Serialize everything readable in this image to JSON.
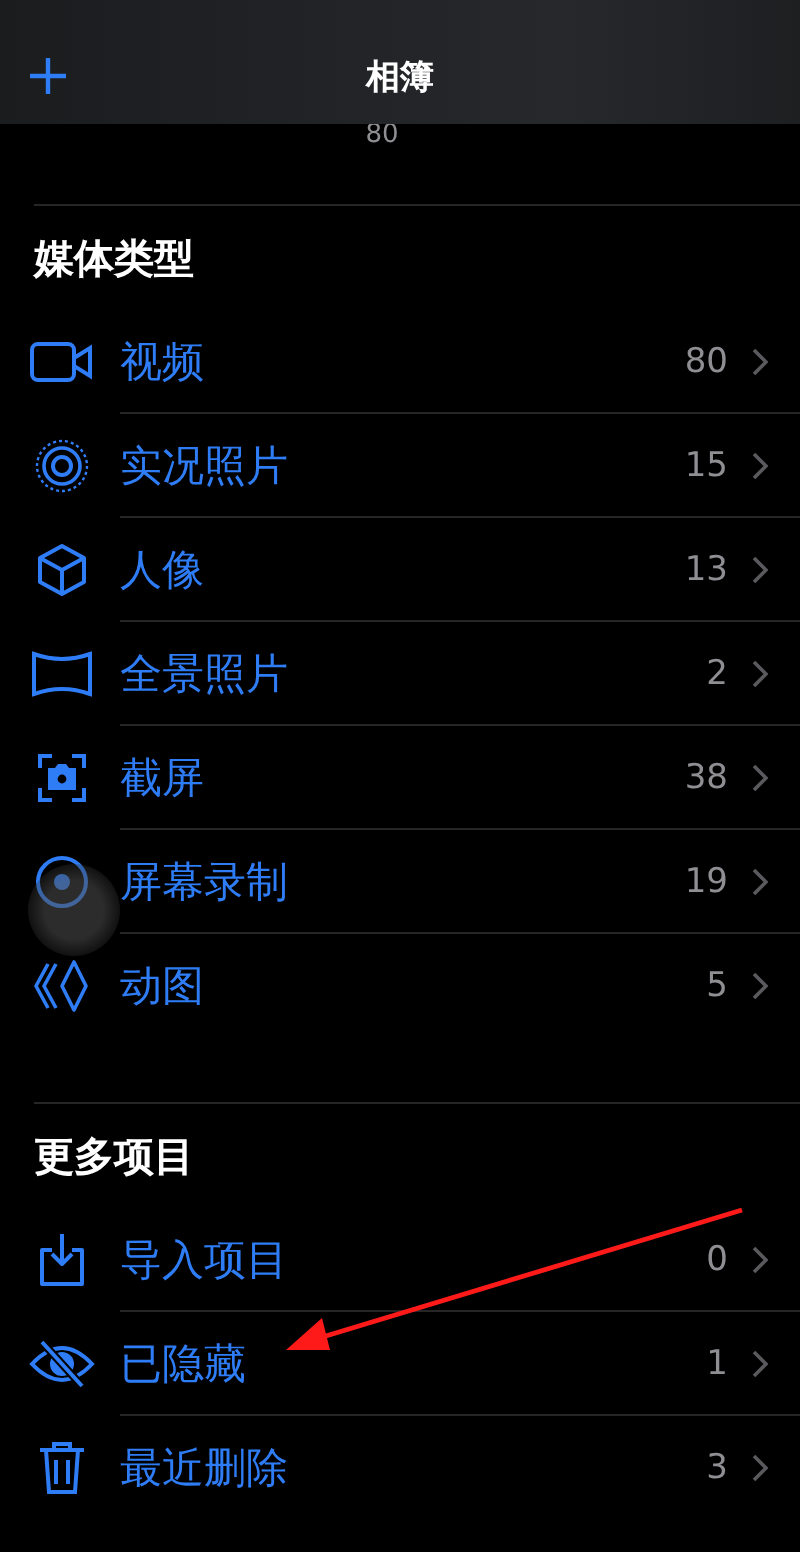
{
  "header": {
    "title": "相簿"
  },
  "scrolled_count": "80",
  "sections": [
    {
      "title": "媒体类型",
      "items": [
        {
          "label": "视频",
          "count": "80"
        },
        {
          "label": "实况照片",
          "count": "15"
        },
        {
          "label": "人像",
          "count": "13"
        },
        {
          "label": "全景照片",
          "count": "2"
        },
        {
          "label": "截屏",
          "count": "38"
        },
        {
          "label": "屏幕录制",
          "count": "19"
        },
        {
          "label": "动图",
          "count": "5"
        }
      ]
    },
    {
      "title": "更多项目",
      "items": [
        {
          "label": "导入项目",
          "count": "0"
        },
        {
          "label": "已隐藏",
          "count": "1"
        },
        {
          "label": "最近删除",
          "count": "3"
        }
      ]
    }
  ]
}
